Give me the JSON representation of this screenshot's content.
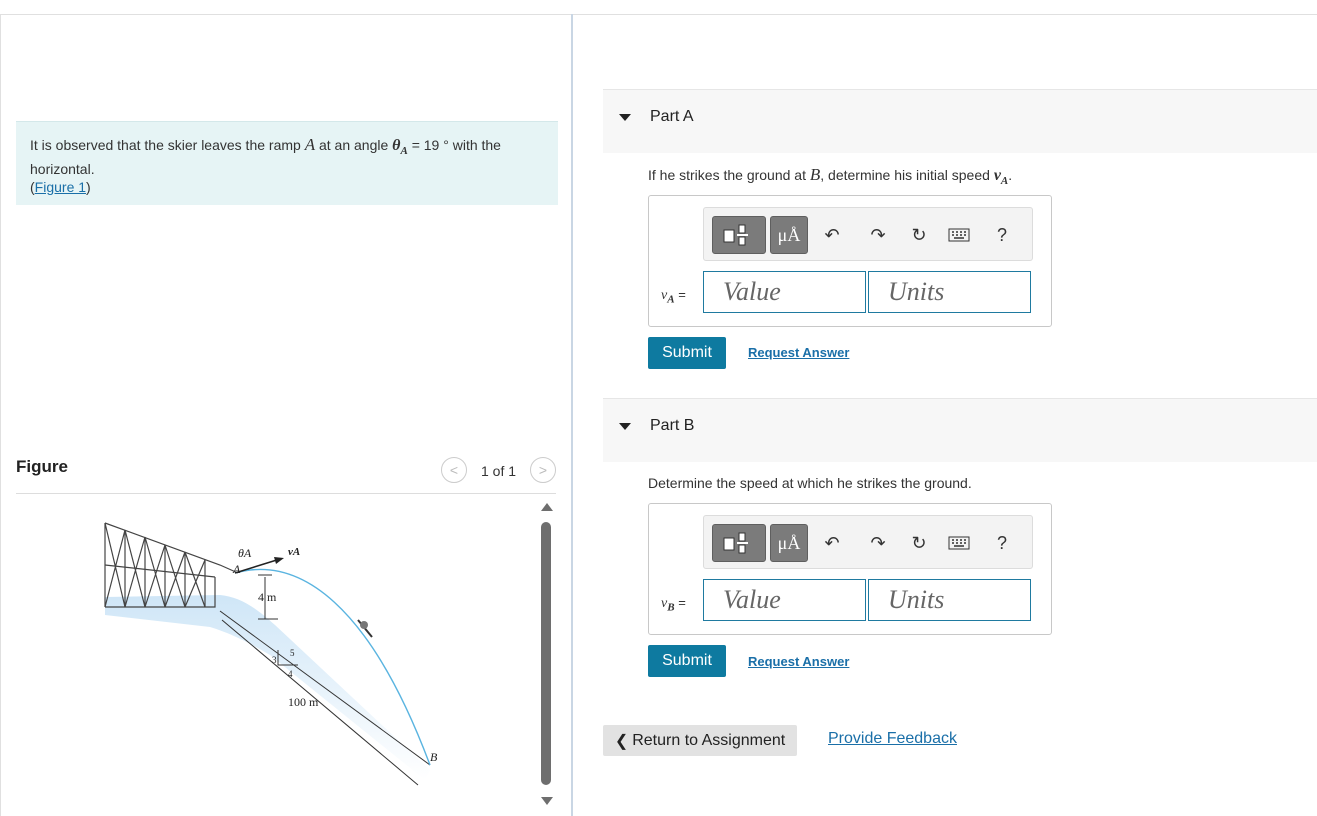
{
  "problem": {
    "text_1": "It is observed that the skier leaves the ramp ",
    "var_A": "A",
    "text_2": " at an angle ",
    "theta": "θ",
    "theta_sub": "A",
    "text_3": " = 19 ° with the horizontal.",
    "figure_link_open": "(",
    "figure_link": "Figure 1",
    "figure_link_close": ")"
  },
  "figure": {
    "title": "Figure",
    "count": "1 of 1",
    "prev": "<",
    "next": ">",
    "labels": {
      "theta_a": "θA",
      "a": "A",
      "va": "vA",
      "height": "4 m",
      "slope_3": "3",
      "slope_4": "4",
      "slope_5": "5",
      "distance": "100 m",
      "b": "B"
    }
  },
  "part_a": {
    "title": "Part A",
    "question_1": "If he strikes the ground at ",
    "question_var": "B",
    "question_2": ", determine his initial speed ",
    "question_v": "v",
    "question_v_sub": "A",
    "question_end": ".",
    "var_label": "v",
    "var_sub": "A",
    "equals": "=",
    "value_placeholder": "Value",
    "units_placeholder": "Units",
    "submit": "Submit",
    "request": "Request Answer"
  },
  "part_b": {
    "title": "Part B",
    "question": "Determine the speed at which he strikes the ground.",
    "var_label": "v",
    "var_sub": "B",
    "equals": "=",
    "value_placeholder": "Value",
    "units_placeholder": "Units",
    "submit": "Submit",
    "request": "Request Answer"
  },
  "toolbar": {
    "mu": "μÅ",
    "help": "?"
  },
  "footer": {
    "return": "Return to Assignment",
    "return_icon": "❮",
    "feedback": "Provide Feedback"
  }
}
